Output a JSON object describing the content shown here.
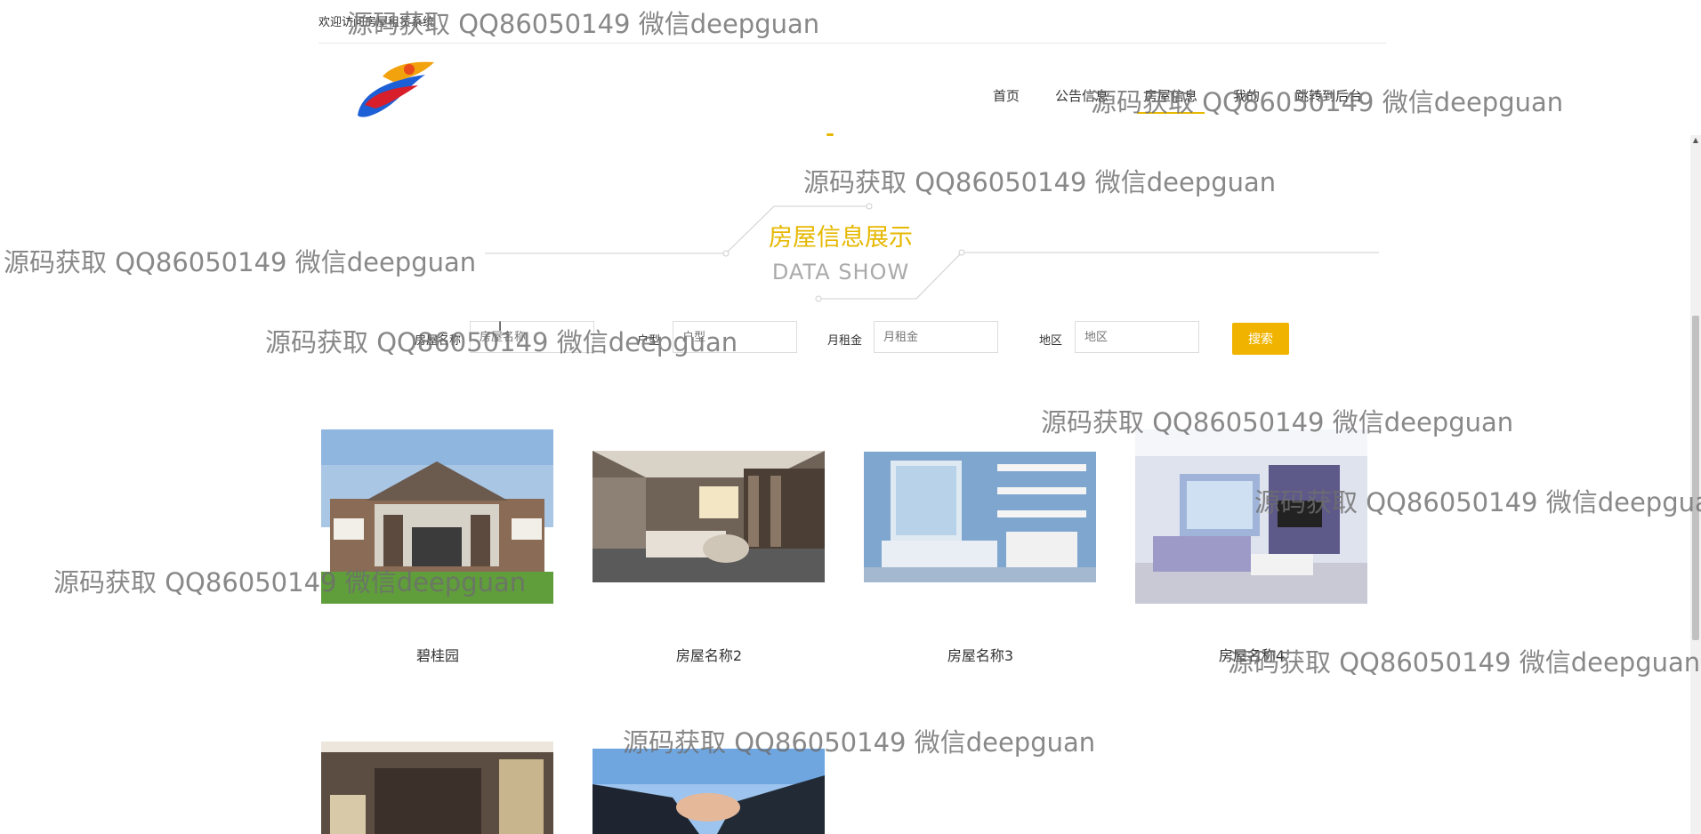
{
  "header": {
    "welcome": "欢迎访问房屋租赁系统"
  },
  "nav": {
    "items": [
      {
        "label": "首页"
      },
      {
        "label": "公告信息"
      },
      {
        "label": "房屋信息"
      },
      {
        "label": "我的"
      },
      {
        "label": "跳转到后台"
      }
    ],
    "active_index": 2
  },
  "section": {
    "title": "房屋信息展示",
    "subtitle": "DATA SHOW"
  },
  "search": {
    "fields": [
      {
        "label": "房屋名称",
        "placeholder": "房屋名称"
      },
      {
        "label": "户型",
        "placeholder": "户型"
      },
      {
        "label": "月租金",
        "placeholder": "月租金"
      },
      {
        "label": "地区",
        "placeholder": "地区"
      }
    ],
    "button_label": "搜索"
  },
  "houses": [
    {
      "name": "碧桂园"
    },
    {
      "name": "房屋名称2"
    },
    {
      "name": "房屋名称3"
    },
    {
      "name": "房屋名称4"
    },
    {
      "name": ""
    },
    {
      "name": ""
    }
  ],
  "watermark": "源码获取 QQ86050149 微信deepguan",
  "colors": {
    "accent": "#e6b800",
    "button": "#f0b400"
  }
}
